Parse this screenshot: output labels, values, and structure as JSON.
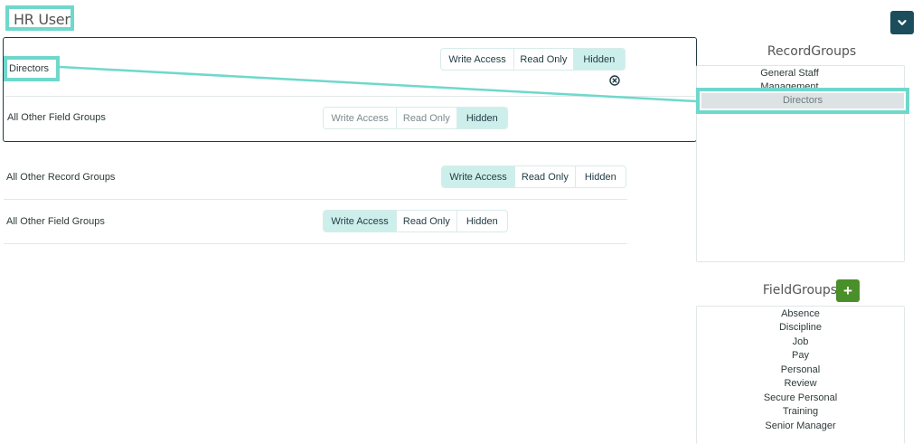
{
  "role": {
    "title": "HR User"
  },
  "access_options": [
    "Write Access",
    "Read Only",
    "Hidden"
  ],
  "panel": {
    "record_group": "Directors",
    "record_access": "Hidden",
    "other_field_groups_label": "All Other Field Groups",
    "other_field_groups_access": "Hidden"
  },
  "defaults": {
    "other_record_groups_label": "All Other Record Groups",
    "other_record_groups_access": "Write Access",
    "other_field_groups_label": "All Other Field Groups",
    "other_field_groups_access": "Write Access"
  },
  "record_groups": {
    "heading": "RecordGroups",
    "items": [
      "General Staff",
      "Management",
      "Directors"
    ],
    "selected": "Directors"
  },
  "field_groups": {
    "heading": "FieldGroups",
    "add_label": "+",
    "items": [
      "Absence",
      "Discipline",
      "Job",
      "Pay",
      "Personal",
      "Review",
      "Secure Personal",
      "Training",
      "Senior Manager"
    ]
  },
  "colors": {
    "highlight": "#6fd8cc",
    "active": "#cdefeb",
    "dark": "#1b4d5c",
    "add": "#4b8f2a"
  },
  "icons": {
    "collapse": "chevron-down-icon",
    "clear": "clear-circle-icon",
    "add": "plus-icon"
  }
}
